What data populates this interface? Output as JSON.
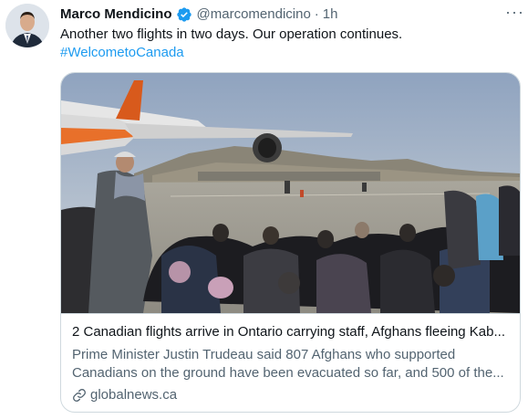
{
  "tweet": {
    "author_name": "Marco Mendicino",
    "author_handle": "@marcomendicino",
    "separator": "·",
    "timestamp": "1h",
    "text": "Another two flights in two days. Our operation continues.",
    "hashtag": "#WelcometoCanada",
    "more_label": "···"
  },
  "card": {
    "title": "2 Canadian flights arrive in Ontario carrying staff, Afghans fleeing Kab...",
    "description": "Prime Minister Justin Trudeau said 807 Afghans who supported Canadians on the ground have been evacuated so far, and 500 of the...",
    "domain": "globalnews.ca"
  },
  "icons": {
    "verified": "verified-badge-icon",
    "more": "more-options-icon",
    "link": "link-icon"
  },
  "colors": {
    "link_blue": "#1d9bf0",
    "secondary_text": "#536471",
    "primary_text": "#0f1419",
    "border": "#cfd9de"
  }
}
